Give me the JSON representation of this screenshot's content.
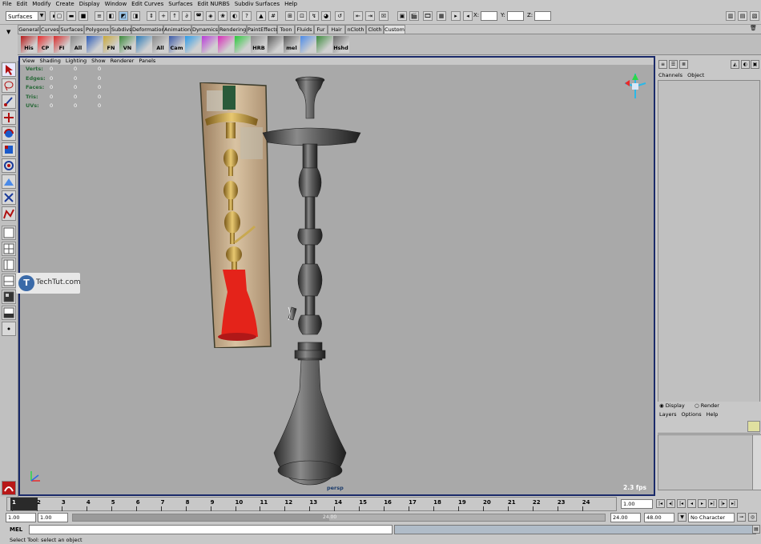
{
  "menubar": [
    "File",
    "Edit",
    "Modify",
    "Create",
    "Display",
    "Window",
    "Edit Curves",
    "Surfaces",
    "Edit NURBS",
    "Subdiv Surfaces",
    "Help"
  ],
  "statusline": {
    "menuset": "Surfaces",
    "coord_x_label": "X:",
    "coord_y_label": "Y:",
    "coord_z_label": "Z:"
  },
  "shelf_tabs": [
    "General",
    "Curves",
    "Surfaces",
    "Polygons",
    "Subdivs",
    "Deformation",
    "Animation",
    "Dynamics",
    "Rendering",
    "PaintEffects",
    "Toon",
    "Fluids",
    "Fur",
    "Hair",
    "nCloth",
    "Cloth",
    "Custom"
  ],
  "shelf_active_tab": "Custom",
  "shelf_icons": [
    "His",
    "CP",
    "FI",
    "All",
    "",
    "FN",
    "VN",
    "",
    "All",
    "Cam",
    "",
    "",
    "",
    "",
    "HRB",
    "",
    "mel",
    "",
    "",
    "Hshd"
  ],
  "panel_menu": [
    "View",
    "Shading",
    "Lighting",
    "Show",
    "Renderer",
    "Panels"
  ],
  "hud": {
    "labels": [
      "Verts:",
      "Edges:",
      "Faces:",
      "Tris:",
      "UVs:"
    ],
    "values": [
      "0",
      "0",
      "0",
      "0",
      "0"
    ]
  },
  "viewport": {
    "camera": "persp",
    "fps": "2.3 fps",
    "watermark": "TechTut.com",
    "watermark_letter": "T"
  },
  "channel_box": {
    "menu": [
      "Channels",
      "Object"
    ]
  },
  "layer_editor": {
    "display_label": "Display",
    "render_label": "Render",
    "menu": [
      "Layers",
      "Options",
      "Help"
    ]
  },
  "timeline": {
    "ticks": [
      "1",
      "2",
      "3",
      "4",
      "5",
      "6",
      "7",
      "8",
      "9",
      "10",
      "11",
      "12",
      "13",
      "14",
      "15",
      "16",
      "17",
      "18",
      "19",
      "20",
      "21",
      "22",
      "23",
      "24"
    ],
    "current_frame": "1.00"
  },
  "range": {
    "start": "1.00",
    "playback_start": "1.00",
    "slider_label": "24.00",
    "playback_end": "24.00",
    "end": "48.00",
    "character_set": "No Character Set"
  },
  "command_line": {
    "label": "MEL"
  },
  "help_line": "Select Tool: select an object",
  "colors": {
    "ui_grey": "#c8c8c8",
    "viewport_bg": "#a9a9a9",
    "viewport_border": "#1a2a6a",
    "hud_label": "#2a6a3a"
  }
}
